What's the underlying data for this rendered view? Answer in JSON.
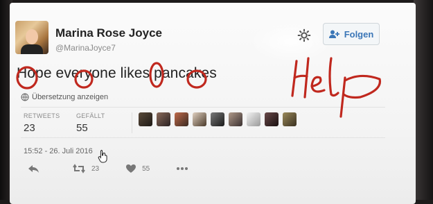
{
  "profile": {
    "display_name": "Marina Rose Joyce",
    "handle": "@MarinaJoyce7"
  },
  "follow_button": {
    "label": "Folgen"
  },
  "tweet": {
    "text": "Hope everyone likes pancakes",
    "translate_label": "Übersetzung anzeigen",
    "timestamp": "15:52 - 26. Juli 2016"
  },
  "stats": {
    "retweets_label": "RETWEETS",
    "retweets_value": "23",
    "likes_label": "GEFÄLLT",
    "likes_value": "55"
  },
  "actions": {
    "reply_icon": "reply-icon",
    "retweet_icon": "retweet-icon",
    "retweet_count": "23",
    "like_icon": "heart-icon",
    "like_count": "55",
    "more_icon": "more-dots-icon"
  },
  "annotation": {
    "handwritten_text": "Help",
    "ink_color": "#c0281e"
  },
  "colors": {
    "follow_blue": "#3a76b7",
    "text_dark": "#222222",
    "muted": "#8a8a8a"
  }
}
